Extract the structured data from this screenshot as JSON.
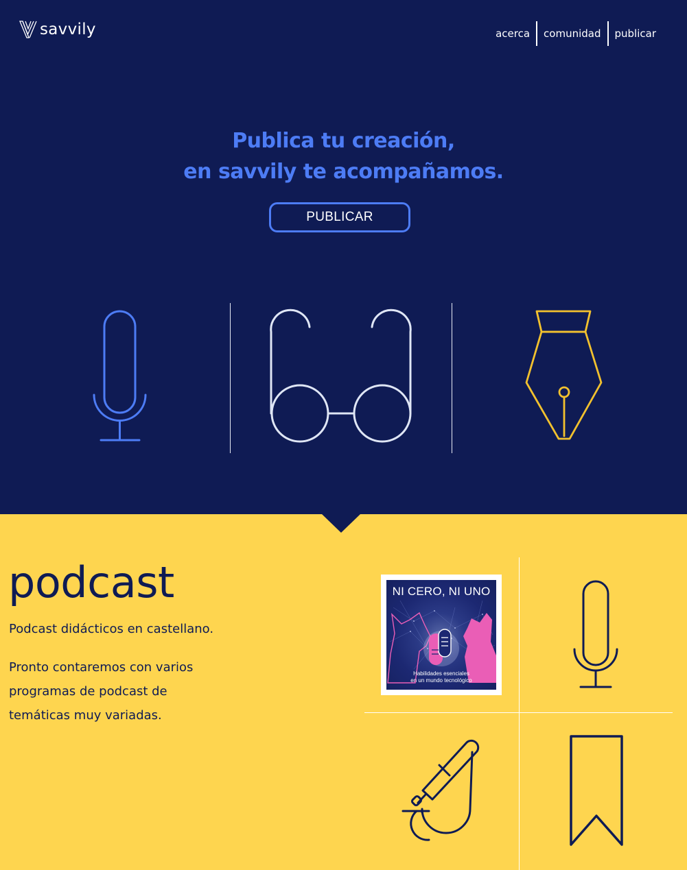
{
  "header": {
    "brand": "savvily",
    "nav": [
      {
        "label": "acerca"
      },
      {
        "label": "comunidad"
      },
      {
        "label": "publicar"
      }
    ]
  },
  "hero": {
    "headline_line1": "Publica tu creación,",
    "headline_line2": "en savvily te acompañamos.",
    "cta_label": "PUBLICAR",
    "icons": [
      "microphone-icon",
      "glasses-icon",
      "fountain-pen-icon"
    ]
  },
  "podcast": {
    "title": "podcast",
    "subtitle": "Podcast didácticos en castellano.",
    "description": "Pronto contaremos con varios programas de podcast de temáticas muy variadas.",
    "cover": {
      "title": "NI CERO, NI UNO",
      "subtitle_line1": "Habilidades esenciales",
      "subtitle_line2": "en un mundo tecnológico"
    },
    "tiles": [
      "microphone-icon",
      "boom-microphone-icon",
      "bookmark-icon"
    ]
  },
  "colors": {
    "navy": "#0f1b54",
    "accent_blue": "#4d7cf5",
    "yellow": "#fed54f",
    "pen_gold": "#f2c12e",
    "light_stroke": "#dfe6f5",
    "cover_pink": "#ea5eb6"
  }
}
